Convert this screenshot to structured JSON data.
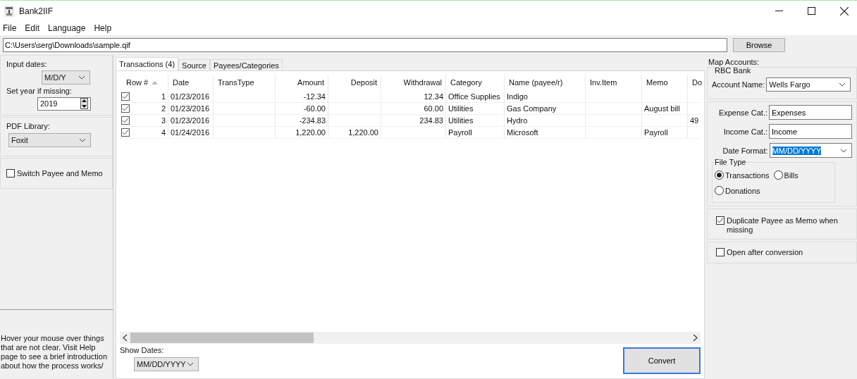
{
  "window": {
    "title": "Bank2IIF"
  },
  "menu": [
    "File",
    "Edit",
    "Language",
    "Help"
  ],
  "path": {
    "value": "C:\\Users\\serg\\Downloads\\sample.qif"
  },
  "browse_button": "Browse",
  "left_panel": {
    "input_dates_label": "Input dates:",
    "input_dates": "M/D/Y",
    "year_label": "Set year if missing:",
    "year": "2019",
    "pdf_label": "PDF Library:",
    "pdf": "Foxit",
    "switch": {
      "label": "Switch Payee and Memo",
      "checked": false
    },
    "help_text": "Hover your mouse over things that are not clear. Visit Help page to see a brief introduction about how the process works/"
  },
  "tabs": [
    {
      "label": "Transactions (4)",
      "selected": true
    },
    {
      "label": "Source",
      "selected": false
    },
    {
      "label": "Payees/Categories",
      "selected": false
    }
  ],
  "table": {
    "columns": [
      "Row #",
      "Date",
      "TransType",
      "Amount",
      "Deposit",
      "Withdrawal",
      "Category",
      "Name (payee/r)",
      "Inv.Item",
      "Memo",
      "Do"
    ],
    "rows": [
      {
        "checked": true,
        "cells": [
          "1",
          "01/23/2016",
          "",
          "-12.34",
          "",
          "12.34",
          "Office Supplies",
          "Indigo",
          "",
          "",
          ""
        ]
      },
      {
        "checked": true,
        "cells": [
          "2",
          "01/23/2016",
          "",
          "-60.00",
          "",
          "60.00",
          "Utilities",
          "Gas Company",
          "",
          "August bill",
          ""
        ]
      },
      {
        "checked": true,
        "cells": [
          "3",
          "01/23/2016",
          "",
          "-234.83",
          "",
          "234.83",
          "Utilities",
          "Hydro",
          "",
          "",
          "49"
        ]
      },
      {
        "checked": true,
        "cells": [
          "4",
          "01/24/2016",
          "",
          "1,220.00",
          "1,220.00",
          "",
          "Payroll",
          "Microsoft",
          "",
          "Payroll",
          ""
        ]
      }
    ]
  },
  "show_dates": {
    "label": "Show Dates:",
    "value": "MM/DD/YYYY"
  },
  "convert_button": "Convert",
  "right_panel": {
    "map_label": "Map Accounts:",
    "bank_group": "RBC Bank",
    "account_label": "Account Name:",
    "account": "Wells Fargo",
    "expense_label": "Expense Cat.:",
    "expense": "Expenses",
    "income_label": "Income Cat.:",
    "income": "Income",
    "date_format_label": "Date Format:",
    "date_format": "MM/DD/YYYY",
    "file_type_label": "File Type",
    "file_types": [
      {
        "label": "Transactions",
        "selected": true
      },
      {
        "label": "Bills",
        "selected": false
      },
      {
        "label": "Donations",
        "selected": false
      }
    ],
    "options": [
      {
        "label": "Duplicate Payee as Memo when missing",
        "checked": true
      },
      {
        "label": "Open after conversion",
        "checked": false
      }
    ]
  }
}
